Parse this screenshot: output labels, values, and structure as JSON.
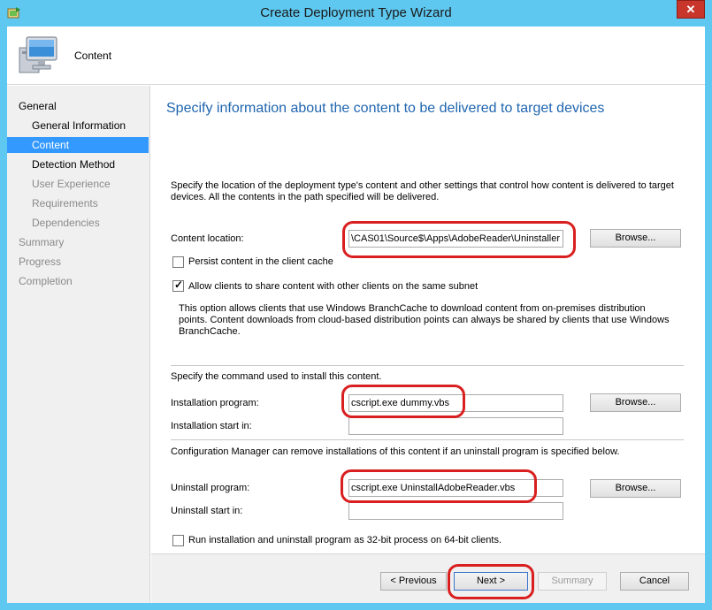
{
  "window": {
    "title": "Create Deployment Type Wizard",
    "close_glyph": "✕"
  },
  "header": {
    "title": "Content"
  },
  "nav": {
    "items": [
      {
        "label": "General",
        "level": 1,
        "state": "active"
      },
      {
        "label": "General Information",
        "level": 2,
        "state": "active"
      },
      {
        "label": "Content",
        "level": 2,
        "state": "selected"
      },
      {
        "label": "Detection Method",
        "level": 2,
        "state": "active"
      },
      {
        "label": "User Experience",
        "level": 2,
        "state": "disabled"
      },
      {
        "label": "Requirements",
        "level": 2,
        "state": "disabled"
      },
      {
        "label": "Dependencies",
        "level": 2,
        "state": "disabled"
      },
      {
        "label": "Summary",
        "level": 1,
        "state": "disabled"
      },
      {
        "label": "Progress",
        "level": 1,
        "state": "disabled"
      },
      {
        "label": "Completion",
        "level": 1,
        "state": "disabled"
      }
    ]
  },
  "main": {
    "heading": "Specify information about the content to be delivered to target devices",
    "intro": "Specify the location of the deployment type's content and other settings that control how content is delivered to target devices. All the contents in the path specified will be delivered.",
    "content_location": {
      "label": "Content location:",
      "value": "\\CAS01\\Source$\\Apps\\AdobeReader\\Uninstaller",
      "browse": "Browse..."
    },
    "persist": {
      "label": "Persist content in the client cache",
      "checked": false
    },
    "allow_share": {
      "label": "Allow clients to share content with other clients on the same subnet",
      "checked": true
    },
    "branchcache_note": "This option allows clients that use Windows BranchCache to download content from on-premises distribution points. Content downloads from cloud-based distribution points can always be shared by clients that use Windows BranchCache.",
    "install_intro": "Specify the command used to install this content.",
    "install_program": {
      "label": "Installation program:",
      "value": "cscript.exe dummy.vbs",
      "browse": "Browse..."
    },
    "install_start": {
      "label": "Installation start in:",
      "value": ""
    },
    "uninstall_intro": "Configuration Manager can remove installations of this content if an uninstall program is specified below.",
    "uninstall_program": {
      "label": "Uninstall program:",
      "value": "cscript.exe UninstallAdobeReader.vbs",
      "browse": "Browse..."
    },
    "uninstall_start": {
      "label": "Uninstall start in:",
      "value": ""
    },
    "run32": {
      "label": "Run installation and uninstall program as 32-bit process on 64-bit clients.",
      "checked": false
    }
  },
  "footer": {
    "previous": "< Previous",
    "next": "Next >",
    "summary": "Summary",
    "cancel": "Cancel"
  },
  "colors": {
    "accent": "#1f66b0",
    "selection": "#3399ff",
    "annotation": "#d91f1f",
    "frame": "#5ec8f0"
  }
}
